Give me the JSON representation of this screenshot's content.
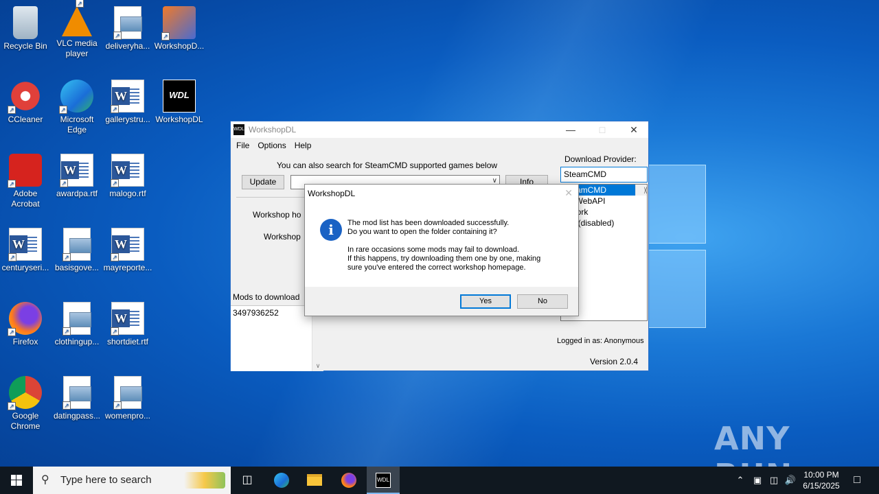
{
  "desktop": {
    "icons": [
      {
        "label": "Recycle Bin",
        "icon": "recycle-bin-icon"
      },
      {
        "label": "VLC media player",
        "icon": "vlc-icon"
      },
      {
        "label": "deliveryha...",
        "icon": "image-file-icon"
      },
      {
        "label": "WorkshopD...",
        "icon": "installer-icon"
      },
      {
        "label": "CCleaner",
        "icon": "ccleaner-icon"
      },
      {
        "label": "Microsoft Edge",
        "icon": "edge-icon"
      },
      {
        "label": "gallerystru...",
        "icon": "word-doc-icon"
      },
      {
        "label": "WorkshopDL",
        "icon": "workshopdl-icon"
      },
      {
        "label": "Adobe Acrobat",
        "icon": "acrobat-icon"
      },
      {
        "label": "awardpa.rtf",
        "icon": "word-doc-icon"
      },
      {
        "label": "malogo.rtf",
        "icon": "word-doc-icon"
      },
      {
        "label": "centuryseri...",
        "icon": "word-doc-icon"
      },
      {
        "label": "basisgove...",
        "icon": "image-file-icon"
      },
      {
        "label": "mayreporte...",
        "icon": "word-doc-icon"
      },
      {
        "label": "Firefox",
        "icon": "firefox-icon"
      },
      {
        "label": "clothingup...",
        "icon": "image-file-icon"
      },
      {
        "label": "shortdiet.rtf",
        "icon": "word-doc-icon"
      },
      {
        "label": "Google Chrome",
        "icon": "chrome-icon"
      },
      {
        "label": "datingpass...",
        "icon": "image-file-icon"
      },
      {
        "label": "womenpro...",
        "icon": "image-file-icon"
      }
    ]
  },
  "window": {
    "title": "WorkshopDL",
    "menu": [
      "File",
      "Options",
      "Help"
    ],
    "search_hint": "You can also search for SteamCMD supported games below",
    "update_label": "Update",
    "info_label": "Info",
    "workshop_homepage_label": "Workshop ho",
    "workshop_label": "Workshop",
    "mods_label": "Mods to download",
    "mods_value": "3497936252",
    "download_provider_label": "Download Provider:",
    "provider_selected": "SteamCMD",
    "provider_options": [
      "SteamCMD",
      "amWebAPI",
      "etwork",
      "her (disabled)",
      ")"
    ],
    "logged_in": "Logged in as: Anonymous",
    "version": "Version 2.0.4"
  },
  "dialog": {
    "title": "WorkshopDL",
    "message": "The mod list has been downloaded successfully.\nDo you want to open the folder containing it?\n\nIn rare occasions some mods may fail to download.\nIf this happens, try downloading them one by one, making\nsure you've entered the correct workshop homepage.",
    "yes_label": "Yes",
    "no_label": "No",
    "icon": "info-icon"
  },
  "taskbar": {
    "search_placeholder": "Type here to search",
    "time": "10:00 PM",
    "date": "6/15/2025"
  },
  "watermark": "ANY RUN"
}
